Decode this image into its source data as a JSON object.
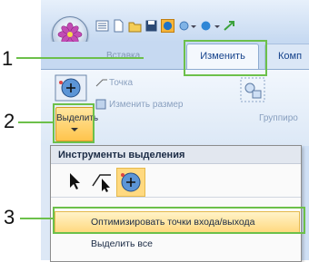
{
  "callouts": {
    "c1": "1",
    "c2": "2",
    "c3": "3"
  },
  "tabs": {
    "left_faded": "Вставка",
    "active": "Изменить",
    "next": "Комп"
  },
  "ribbon": {
    "point_label": "Точка",
    "resize_label": "Изменить размер",
    "select_label": "Выделить",
    "group_label": "Группиро"
  },
  "menu": {
    "header": "Инструменты выделения",
    "optimize_label": "Оптимизировать точки входа/выхода",
    "select_all_label": "Выделить все"
  },
  "colors": {
    "callout": "#6cc04a",
    "highlight": "#ffd980",
    "tab_text": "#15428b"
  }
}
